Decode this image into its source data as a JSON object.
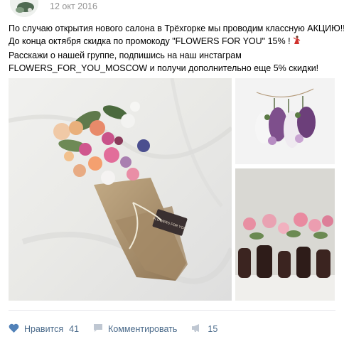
{
  "post": {
    "date": "12 окт 2016",
    "text_lines": [
      "По случаю открытия нового салона в Трёхгорке мы проводим классную АКЦИЮ!!",
      "До конца октября скидка по промокоду \"FLOWERS FOR YOU\" 15% !",
      "Расскажи о нашей группе, подпишись на наш инстаграм",
      "FLOWERS_FOR_YOU_MOSCOW и получи дополнительно еще 5% скидки!"
    ],
    "tag_text": "FLOWERS FOR YOU"
  },
  "actions": {
    "like_label": "Нравится",
    "like_count": "41",
    "comment_label": "Комментировать",
    "repost_count": "15"
  },
  "colors": {
    "accent": "#4a76a8",
    "action_text": "#4a6a8a",
    "date_text": "#939393"
  },
  "icons": [
    "heart-icon",
    "comment-icon",
    "megaphone-icon",
    "dancer-emoji"
  ]
}
